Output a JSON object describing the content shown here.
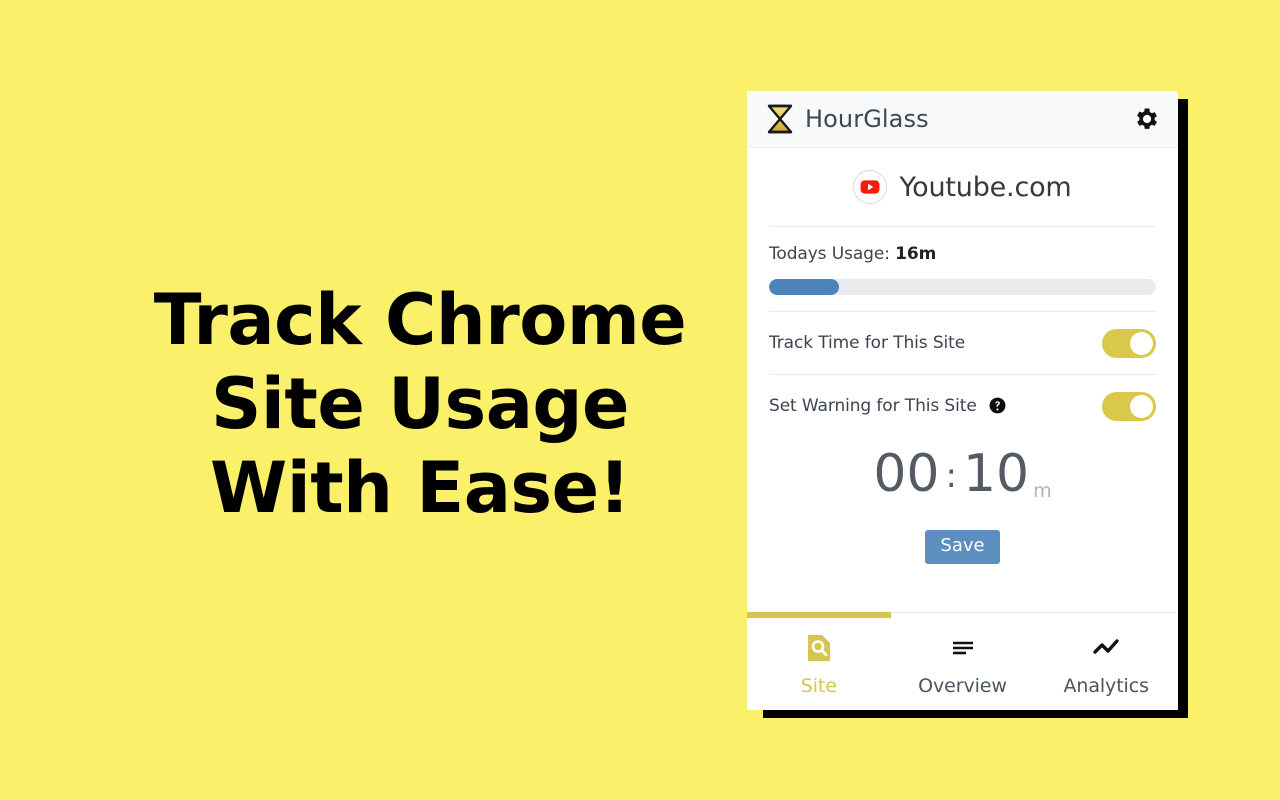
{
  "page": {
    "background_color": "#fbf06a",
    "headline_lines": [
      "Track Chrome",
      "Site Usage",
      "With Ease!"
    ]
  },
  "popup": {
    "header": {
      "logo_icon": "hourglass-icon",
      "brand_name": "HourGlass",
      "settings_icon": "gear-icon"
    },
    "site": {
      "favicon": "youtube-icon",
      "name": "Youtube.com"
    },
    "usage": {
      "label_prefix": "Todays Usage:",
      "value": "16m",
      "progress_percent": 18,
      "progress_fill_color": "#4b84b8",
      "progress_track_color": "#e9ecef"
    },
    "track_toggle": {
      "label": "Track Time for This Site",
      "state": "on",
      "on_color": "#d9c84a"
    },
    "warning_toggle": {
      "label": "Set Warning for This Site",
      "help_icon": "help-circle-icon",
      "state": "on",
      "on_color": "#d9c84a"
    },
    "timer": {
      "hours": "00",
      "separator": ":",
      "minutes": "10",
      "unit": "m",
      "save_label": "Save",
      "save_color": "#5b8fc0"
    },
    "nav": {
      "active_color": "#d6c551",
      "tabs": [
        {
          "label": "Site",
          "icon": "site-search-doc-icon",
          "active": true
        },
        {
          "label": "Overview",
          "icon": "list-lines-icon",
          "active": false
        },
        {
          "label": "Analytics",
          "icon": "line-chart-icon",
          "active": false
        }
      ]
    }
  }
}
